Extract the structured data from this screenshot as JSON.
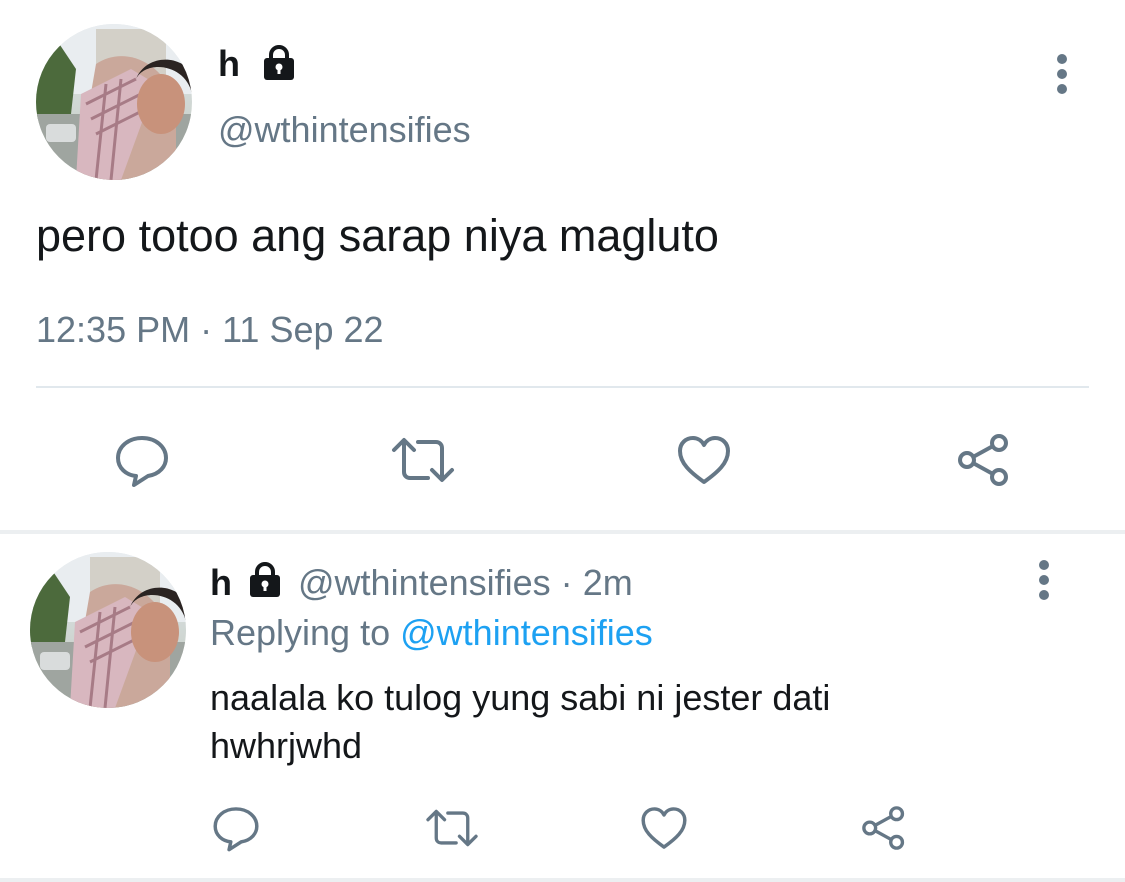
{
  "main_tweet": {
    "name": "h",
    "handle": "@wthintensifies",
    "text": "pero totoo ang sarap niya magluto",
    "timestamp": "12:35 PM · 11 Sep 22",
    "icons": {
      "lock": "lock-icon",
      "more": "more-vertical-icon",
      "reply": "reply-icon",
      "retweet": "retweet-icon",
      "like": "heart-icon",
      "share": "share-icon"
    }
  },
  "reply_tweet": {
    "name": "h",
    "handle": "@wthintensifies",
    "separator": "·",
    "time": "2m",
    "replying_prefix": "Replying to",
    "replying_mention": "@wthintensifies",
    "text_line1": "naalala ko tulog yung sabi ni jester dati",
    "text_line2": "hwhrjwhd"
  },
  "colors": {
    "text": "#14171a",
    "secondary": "#657786",
    "link": "#1da1f2",
    "icon": "#657786",
    "divider": "#e1e8ed"
  }
}
